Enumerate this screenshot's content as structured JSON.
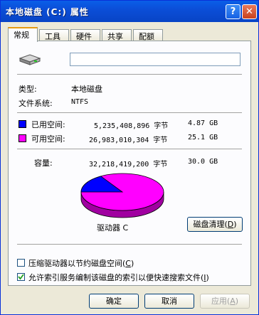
{
  "window": {
    "title": "本地磁盘 (C:) 属性",
    "help_label": "?",
    "close_label": "✕"
  },
  "tabs": [
    {
      "label": "常规",
      "active": true
    },
    {
      "label": "工具",
      "active": false
    },
    {
      "label": "硬件",
      "active": false
    },
    {
      "label": "共享",
      "active": false
    },
    {
      "label": "配额",
      "active": false
    }
  ],
  "general": {
    "drive_icon": "hard-drive-icon",
    "name_value": "",
    "type_label": "类型:",
    "type_value": "本地磁盘",
    "fs_label": "文件系统:",
    "fs_value": "NTFS",
    "used": {
      "label": "已用空间:",
      "bytes": "5,235,408,896 字节",
      "size": "4.87 GB",
      "color": "#0000ff"
    },
    "free": {
      "label": "可用空间:",
      "bytes": "26,983,010,304 字节",
      "size": "25.1 GB",
      "color": "#ff00ff"
    },
    "capacity": {
      "label": "容量:",
      "bytes": "32,218,419,200 字节",
      "size": "30.0 GB"
    },
    "drive_label": "驱动器 C",
    "cleanup_button": "磁盘清理(D)",
    "compress_label": "压缩驱动器以节约磁盘空间(C)",
    "compress_checked": false,
    "index_label": "允许索引服务编制该磁盘的索引以便快速搜索文件(I)",
    "index_checked": true
  },
  "buttons": {
    "ok": "确定",
    "cancel": "取消",
    "apply": "应用(A)"
  },
  "pie": {
    "used_fraction": 0.1625
  }
}
